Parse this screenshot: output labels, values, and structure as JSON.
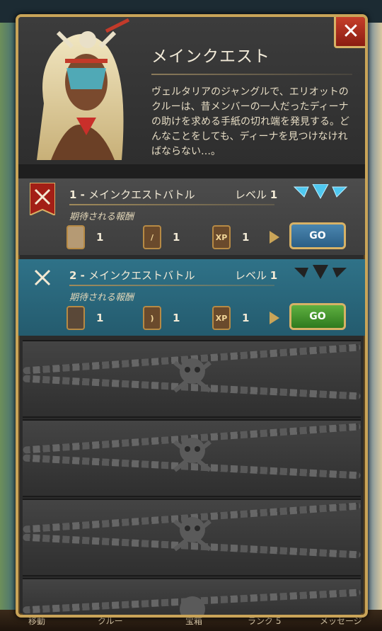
{
  "background": {
    "nav": [
      "移動",
      "クルー",
      "宝箱",
      "ランク",
      "メッセージ"
    ],
    "rank_num": "5"
  },
  "modal": {
    "title": "メインクエスト",
    "description": "ヴェルタリアのジャングルで、エリオットのクルーは、昔メンバーの一人だったディーナの助けを求める手紙の切れ端を発見する。どんなことをしても、ディーナを見つけなければならない…。",
    "close_label": "✕"
  },
  "quests": [
    {
      "number": "1 -",
      "name": "メインクエストバトル",
      "level_label": "レベル",
      "level": "1",
      "reward_label": "期待される報酬",
      "rewards": [
        {
          "icon": "card-portrait-icon",
          "qty": "1"
        },
        {
          "icon": "spear-icon",
          "qty": "1"
        },
        {
          "icon": "xp-icon",
          "text": "XP",
          "qty": "1"
        }
      ],
      "go_label": "GO",
      "go_color": "#3b75a0",
      "badge": "crossed-swords-banner-icon"
    },
    {
      "number": "2 -",
      "name": "メインクエストバトル",
      "level_label": "レベル",
      "level": "1",
      "reward_label": "期待される報酬",
      "rewards": [
        {
          "icon": "card-portrait-icon",
          "qty": "1"
        },
        {
          "icon": "scimitar-icon",
          "qty": "1"
        },
        {
          "icon": "xp-icon",
          "text": "XP",
          "qty": "1"
        }
      ],
      "go_label": "GO",
      "go_color": "#3e9428",
      "badge": "crossed-swords-icon"
    }
  ],
  "locked_rows": 4
}
